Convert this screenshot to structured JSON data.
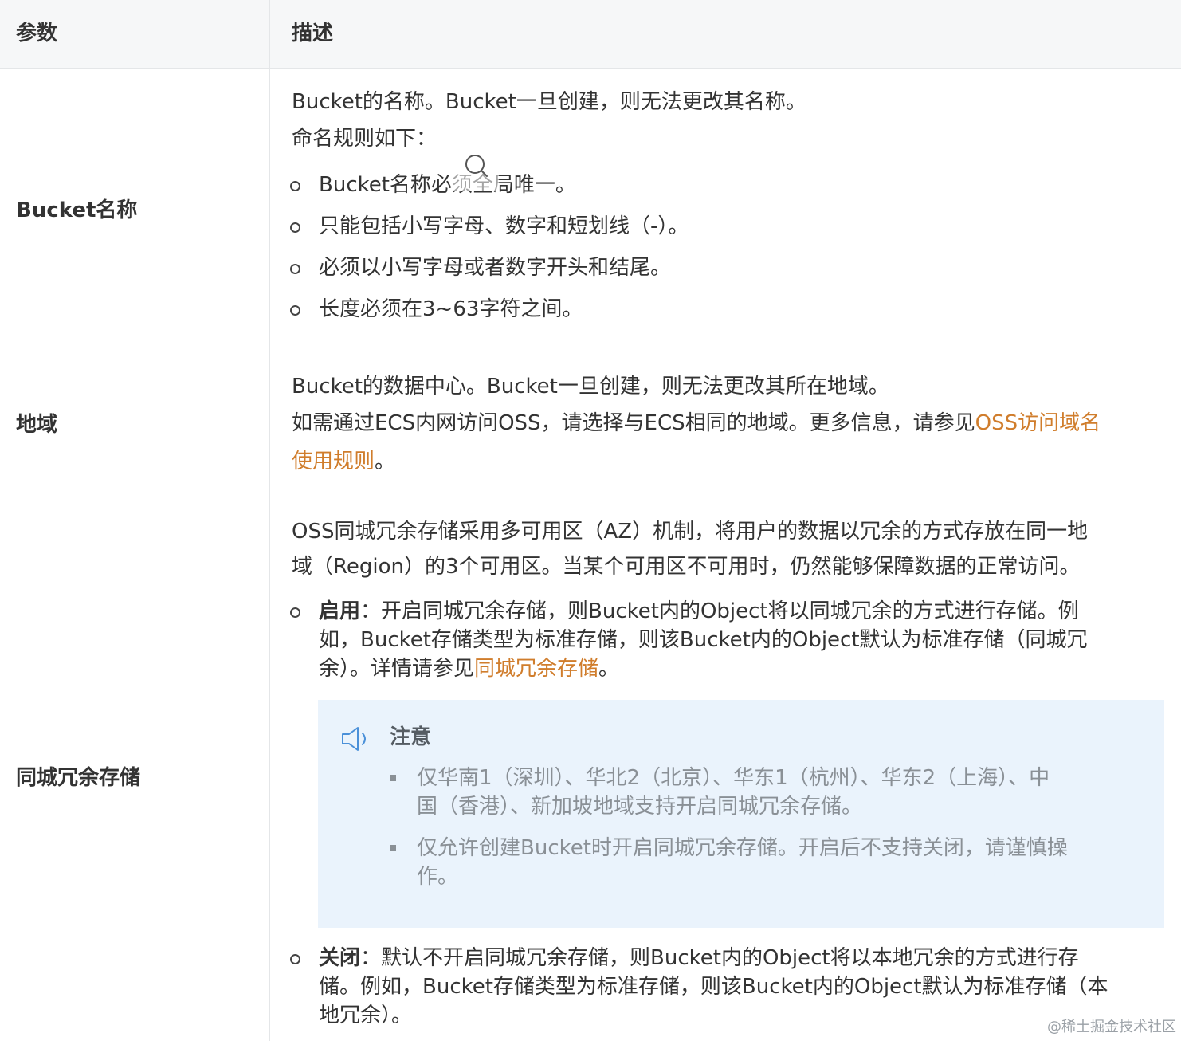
{
  "header": {
    "col_param": "参数",
    "col_desc": "描述"
  },
  "rows": {
    "bucket_name": {
      "param": "Bucket名称",
      "desc_line1": "Bucket的名称。Bucket一旦创建，则无法更改其名称。",
      "desc_line2": "命名规则如下：",
      "rules": [
        "Bucket名称必须全局唯一。",
        "只能包括小写字母、数字和短划线（-）。",
        "必须以小写字母或者数字开头和结尾。",
        "长度必须在3~63字符之间。"
      ]
    },
    "region": {
      "param": "地域",
      "desc_line1": "Bucket的数据中心。Bucket一旦创建，则无法更改其所在地域。",
      "desc_line2_prefix": "如需通过ECS内网访问OSS，请选择与ECS相同的地域。更多信息，请参见",
      "link_part1": "OSS访问域名",
      "link_part2": "使用规则",
      "desc_suffix": "。"
    },
    "zrs": {
      "param": "同城冗余存储",
      "intro_line1": "OSS同城冗余存储采用多可用区（AZ）机制，将用户的数据以冗余的方式存放在同一地",
      "intro_line2": "域（Region）的3个可用区。当某个可用区不可用时，仍然能够保障数据的正常访问。",
      "enable_label": "启用",
      "enable_line1": "：开启同城冗余存储，则Bucket内的Object将以同城冗余的方式进行存储。例",
      "enable_line2": "如，Bucket存储类型为标准存储，则该Bucket内的Object默认为标准存储（同城冗",
      "enable_line3_prefix": "余）。详情请参见",
      "enable_link": "同城冗余存储",
      "enable_line3_suffix": "。",
      "note": {
        "title": "注意",
        "item1_line1": "仅华南1（深圳）、华北2（北京）、华东1（杭州）、华东2（上海）、中",
        "item1_line2": "国（香港）、新加坡地域支持开启同城冗余存储。",
        "item2_line1": "仅允许创建Bucket时开启同城冗余存储。开启后不支持关闭，请谨慎操",
        "item2_line2": "作。"
      },
      "disable_label": "关闭",
      "disable_line1": "：默认不开启同城冗余存储，则Bucket内的Object将以本地冗余的方式进行存",
      "disable_line2": "储。例如，Bucket存储类型为标准存储，则该Bucket内的Object默认为标准存储（本",
      "disable_line3": "地冗余）。"
    }
  },
  "watermark": "@稀土掘金技术社区",
  "colors": {
    "link": "#d07d2c",
    "note_bg": "#eaf3fc",
    "header_bg": "#f6f7f8"
  }
}
